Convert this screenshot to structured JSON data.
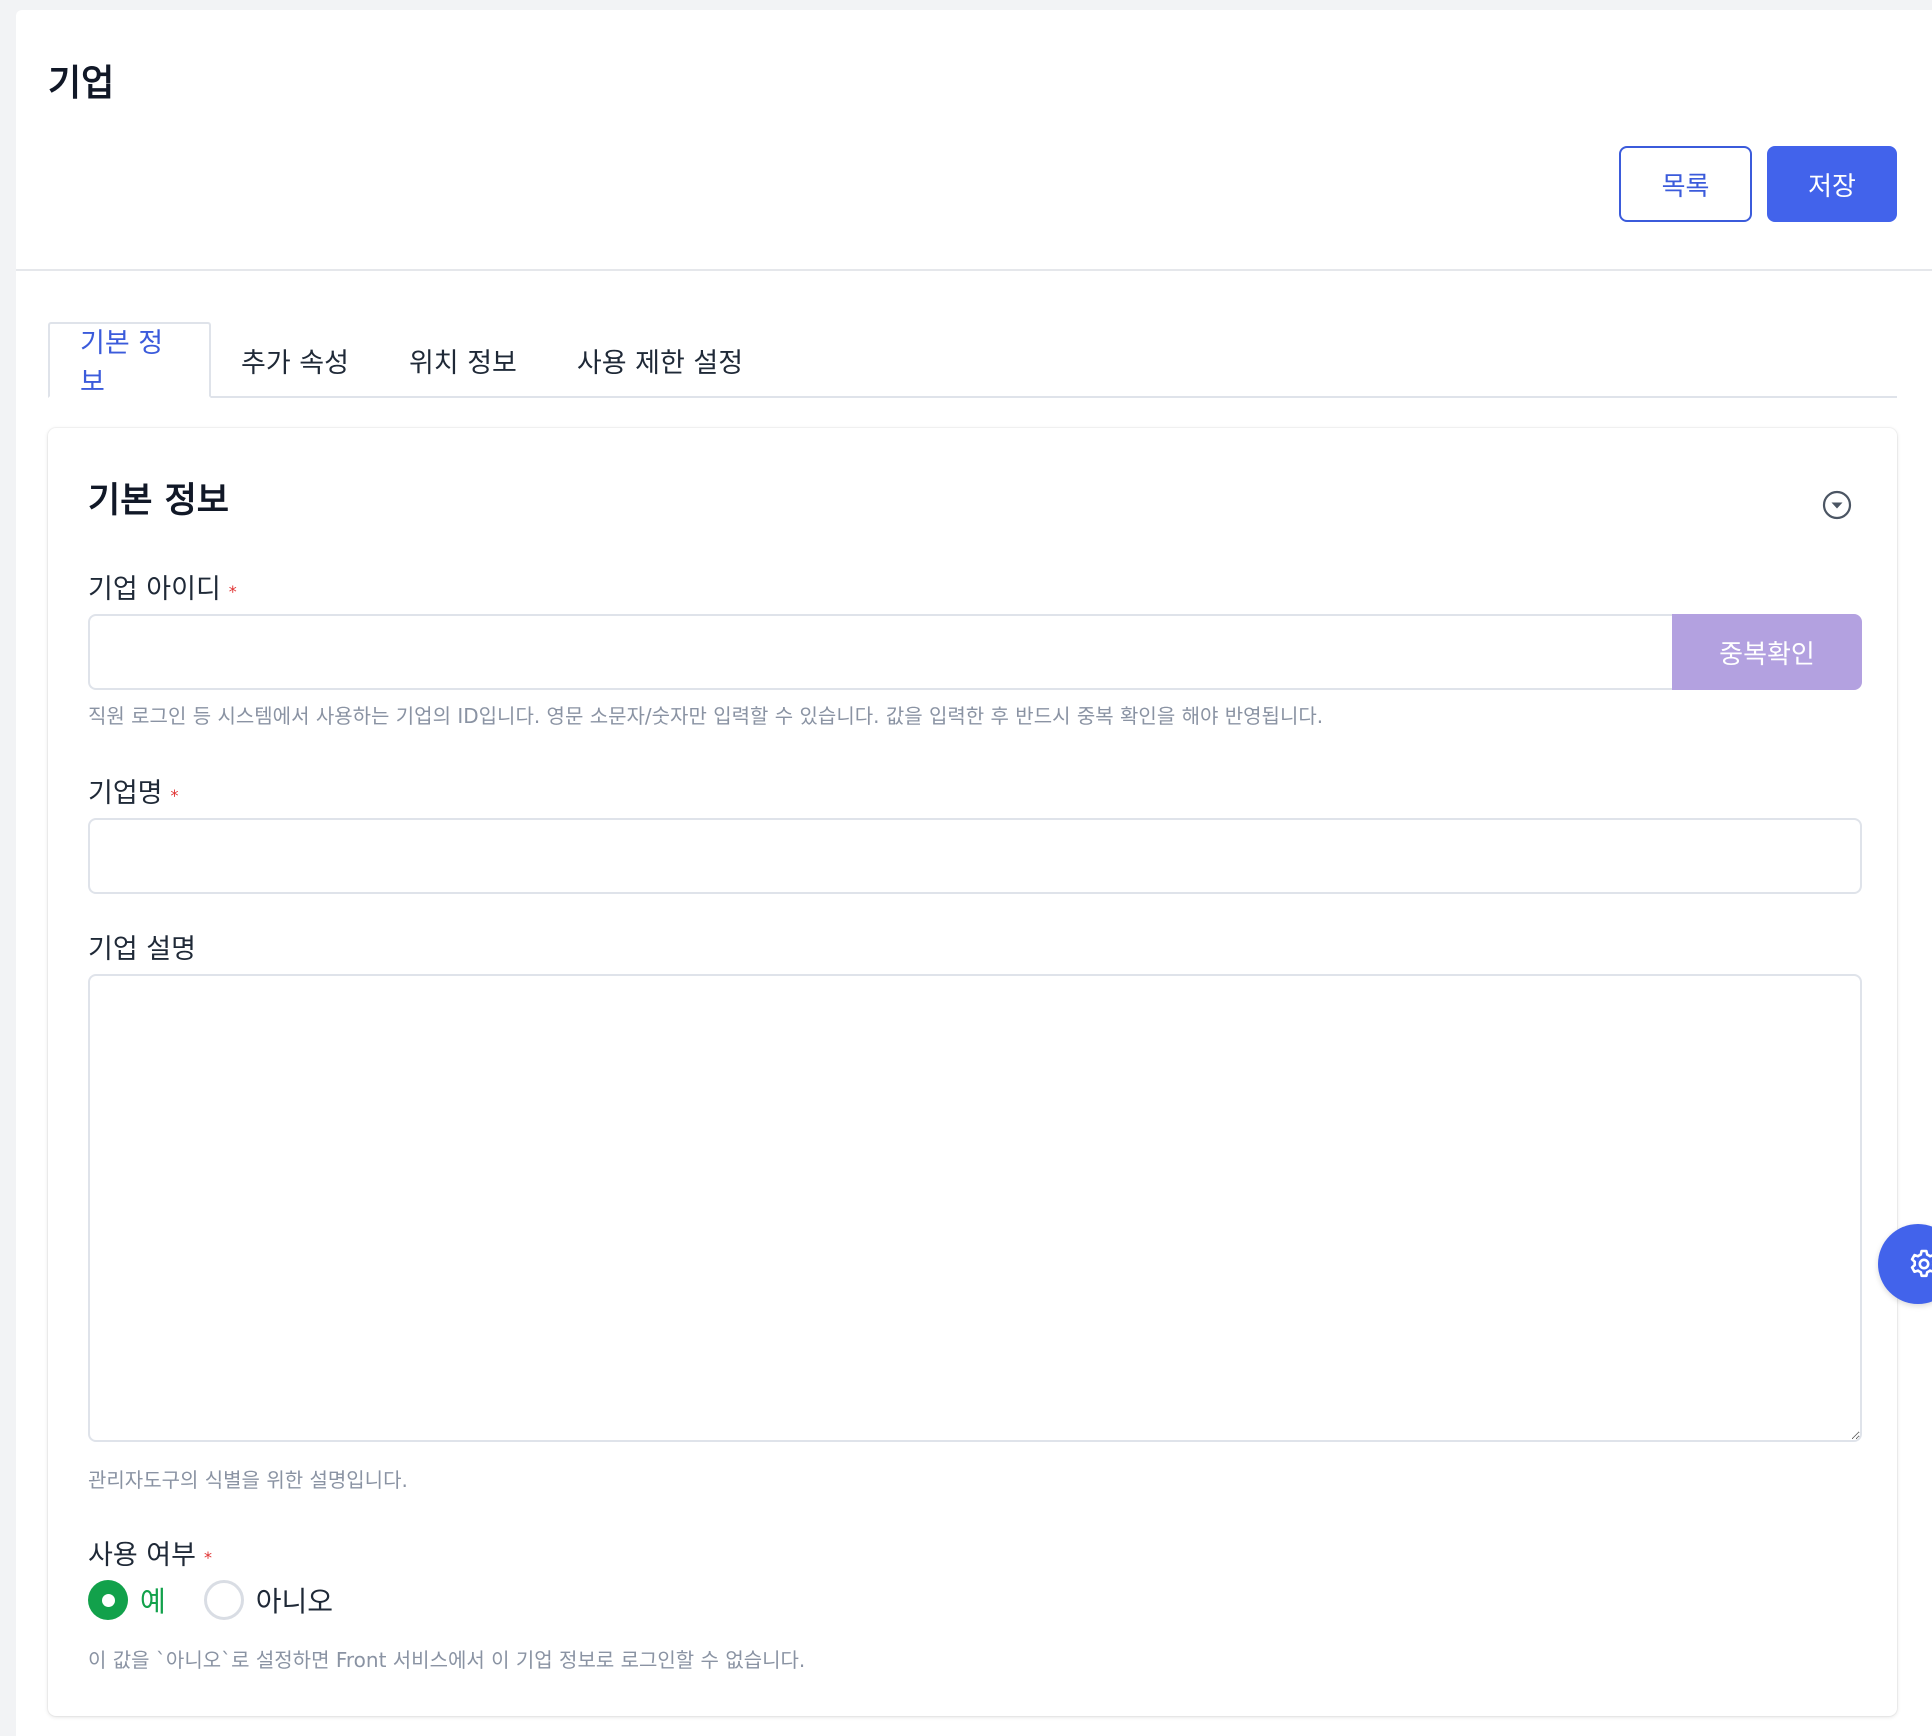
{
  "header": {
    "title": "기업",
    "list_button": "목록",
    "save_button": "저장"
  },
  "tabs": [
    {
      "label": "기본 정보",
      "active": true
    },
    {
      "label": "추가 속성",
      "active": false
    },
    {
      "label": "위치 정보",
      "active": false
    },
    {
      "label": "사용 제한 설정",
      "active": false
    }
  ],
  "card": {
    "title": "기본 정보",
    "collapse_icon": "chevron-down-circle-icon"
  },
  "fields": {
    "company_id": {
      "label": "기업 아이디",
      "required_mark": "*",
      "value": "",
      "placeholder": "",
      "check_button": "중복확인",
      "help": "직원 로그인 등 시스템에서 사용하는 기업의 ID입니다. 영문 소문자/숫자만 입력할 수 있습니다. 값을 입력한 후 반드시 중복 확인을 해야 반영됩니다."
    },
    "company_name": {
      "label": "기업명",
      "required_mark": "*",
      "value": "",
      "placeholder": ""
    },
    "description": {
      "label": "기업 설명",
      "value": "",
      "help": "관리자도구의 식별을 위한 설명입니다."
    },
    "usage": {
      "label": "사용 여부",
      "required_mark": "*",
      "options": [
        {
          "label": "예",
          "selected": true
        },
        {
          "label": "아니오",
          "selected": false
        }
      ],
      "help": "이 값을 `아니오`로 설정하면 Front 서비스에서 이 기업 정보로 로그인할 수 없습니다."
    }
  },
  "floating_button": {
    "icon": "gear-icon"
  },
  "colors": {
    "primary": "#4263eb",
    "primary_border": "#3b5bdb",
    "disabled_check_button": "#b3a1e0",
    "success": "#12a14b",
    "required": "#e03131",
    "help_text": "#8a93a3"
  }
}
